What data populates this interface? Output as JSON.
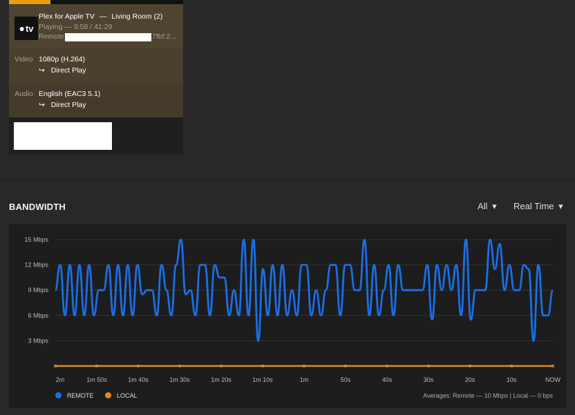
{
  "session": {
    "player": "Plex for Apple TV",
    "separator": "—",
    "device": "Living Room (2)",
    "icon_text": "tv",
    "state": "Playing — 9:58 / 41:29",
    "progress_fraction": 0.24,
    "remote_label": "Remote",
    "remote_suffix": "7fbf:2...",
    "video_label": "Video",
    "video_value": "1080p (H.264)",
    "video_mode": "Direct Play",
    "audio_label": "Audio",
    "audio_value": "English (EAC3 5.1)",
    "audio_mode": "Direct Play",
    "arrow": "↪"
  },
  "bandwidth": {
    "title": "BANDWIDTH",
    "filter_all": "All",
    "filter_time": "Real Time",
    "caret": "▾",
    "legend_remote": "REMOTE",
    "legend_local": "LOCAL",
    "averages": "Averages: Remote — 10 Mbps | Local — 0 bps",
    "colors": {
      "remote": "#1a6fe6",
      "local": "#e58a1c",
      "grid": "#333333"
    }
  },
  "chart_data": {
    "type": "line",
    "ylim": [
      0,
      15
    ],
    "y_ticks": [
      "15 Mbps",
      "12 Mbps",
      "9 Mbps",
      "6 Mbps",
      "3 Mbps"
    ],
    "y_tick_values": [
      15,
      12,
      9,
      6,
      3
    ],
    "x_ticks": [
      "2m",
      "1m 50s",
      "1m 40s",
      "1m 30s",
      "1m 20s",
      "1m 10s",
      "1m",
      "50s",
      "40s",
      "30s",
      "20s",
      "10s",
      "NOW"
    ],
    "series": [
      {
        "name": "REMOTE",
        "values": [
          9,
          12,
          6,
          12,
          6,
          12,
          6,
          12,
          6,
          9,
          9,
          12,
          6,
          12,
          6,
          12,
          6,
          12,
          8.5,
          9,
          9,
          6,
          12,
          9,
          6,
          12,
          15,
          8.5,
          9,
          6,
          12,
          12,
          6,
          12,
          10.5,
          10.5,
          6,
          9,
          6,
          15,
          6,
          15,
          3,
          11.5,
          6,
          12,
          6,
          12,
          6,
          9,
          6,
          12,
          12,
          6,
          9,
          6,
          9,
          12,
          12,
          6,
          12,
          12,
          9,
          9,
          15,
          6,
          12,
          6,
          9,
          12,
          6,
          12,
          9,
          9,
          9,
          9,
          9,
          12,
          5.5,
          12,
          9,
          12,
          9,
          12,
          6,
          15,
          5.5,
          9,
          9,
          9,
          15,
          11.5,
          14.5,
          9,
          12,
          9,
          9,
          12,
          11.5,
          3,
          12,
          6,
          6,
          9
        ]
      },
      {
        "name": "LOCAL",
        "values": [
          0,
          0,
          0,
          0,
          0,
          0,
          0,
          0,
          0,
          0,
          0,
          0,
          0
        ]
      }
    ]
  }
}
